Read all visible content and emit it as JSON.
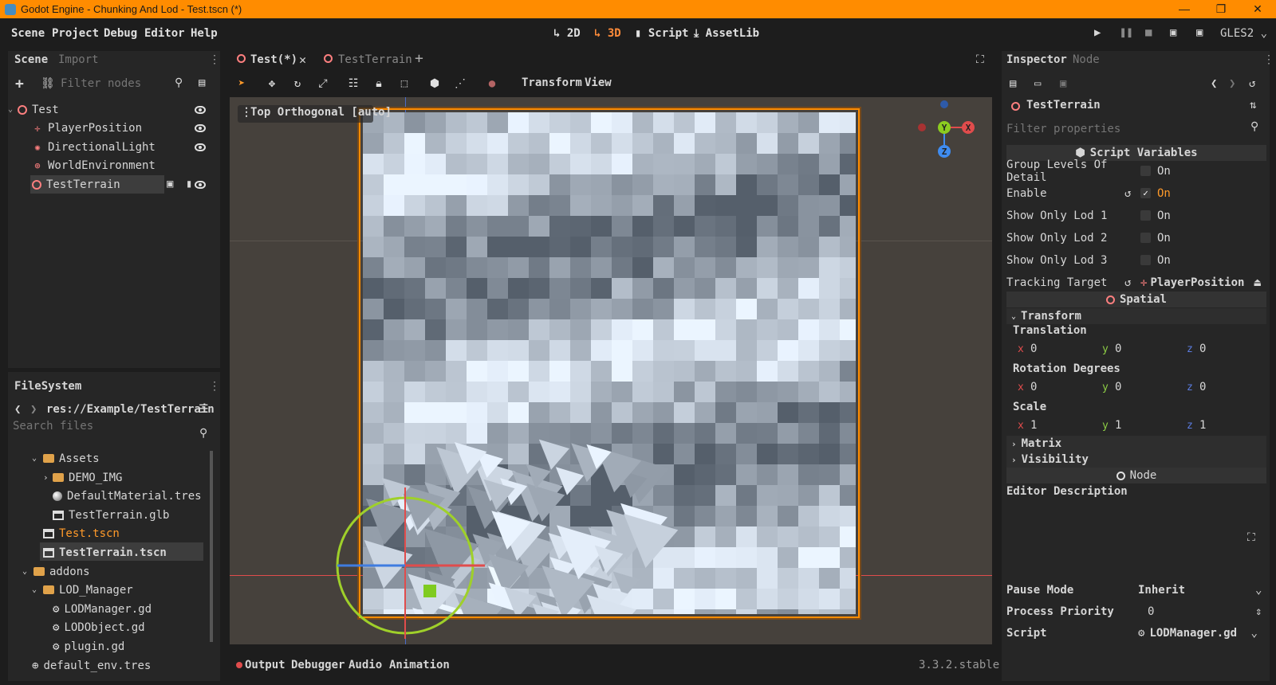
{
  "window": {
    "title": "Godot Engine - Chunking And Lod - Test.tscn (*)",
    "minimize": "—",
    "maximize": "❐",
    "close": "✕"
  },
  "menu": [
    "Scene",
    "Project",
    "Debug",
    "Editor",
    "Help"
  ],
  "workspaces": {
    "w2d": "2D",
    "w3d": "3D",
    "script": "Script",
    "assetlib": "AssetLib"
  },
  "renderer": "GLES2",
  "scene_dock": {
    "tabs": [
      "Scene",
      "Import"
    ],
    "filter_placeholder": "Filter nodes",
    "tree": [
      {
        "label": "Test"
      },
      {
        "label": "PlayerPosition"
      },
      {
        "label": "DirectionalLight"
      },
      {
        "label": "WorldEnvironment"
      },
      {
        "label": "TestTerrain"
      }
    ]
  },
  "filesystem": {
    "title": "FileSystem",
    "path": "res://Example/TestTerrain",
    "search_placeholder": "Search files",
    "items": [
      "Assets",
      "DEMO_IMG",
      "DefaultMaterial.tres",
      "TestTerrain.glb",
      "Test.tscn",
      "TestTerrain.tscn",
      "addons",
      "LOD_Manager",
      "LODManager.gd",
      "LODObject.gd",
      "plugin.gd",
      "default_env.tres"
    ]
  },
  "editor_tabs": [
    "Test(*)",
    "TestTerrain"
  ],
  "viewport": {
    "menus": [
      "Transform",
      "View"
    ],
    "label": "Top Orthogonal [auto]"
  },
  "bottom_tabs": [
    "Output",
    "Debugger",
    "Audio",
    "Animation"
  ],
  "version": "3.3.2.stable",
  "inspector": {
    "tabs": [
      "Inspector",
      "Node"
    ],
    "node_name": "TestTerrain",
    "filter_placeholder": "Filter properties",
    "script_vars_title": "Script Variables",
    "properties": [
      {
        "label": "Group Levels Of Detail",
        "value": "On"
      },
      {
        "label": "Enable",
        "value": "On"
      },
      {
        "label": "Show Only Lod 1",
        "value": "On"
      },
      {
        "label": "Show Only Lod 2",
        "value": "On"
      },
      {
        "label": "Show Only Lod 3",
        "value": "On"
      }
    ],
    "tracking_target": {
      "label": "Tracking Target",
      "value": "PlayerPosition"
    },
    "spatial_title": "Spatial",
    "transform_title": "Transform",
    "translation": {
      "label": "Translation",
      "x": "0",
      "y": "0",
      "z": "0"
    },
    "rotation": {
      "label": "Rotation Degrees",
      "x": "0",
      "y": "0",
      "z": "0"
    },
    "scale": {
      "label": "Scale",
      "x": "1",
      "y": "1",
      "z": "1"
    },
    "matrix": "Matrix",
    "visibility": "Visibility",
    "node_title": "Node",
    "editor_description": "Editor Description",
    "pause_mode": {
      "label": "Pause Mode",
      "value": "Inherit"
    },
    "process_priority": {
      "label": "Process Priority",
      "value": "0"
    },
    "script": {
      "label": "Script",
      "value": "LODManager.gd"
    }
  },
  "axis_letters": {
    "x": "x",
    "y": "y",
    "z": "z"
  },
  "gizmo": {
    "X": "X",
    "Y": "Y",
    "Z": "Z"
  },
  "colors": {
    "accent": "#ff8c00",
    "selected_file": "#ff9a2a",
    "x_axis": "#e04c4c",
    "y_axis": "#8ccc45",
    "z_axis": "#5b7ce0"
  }
}
